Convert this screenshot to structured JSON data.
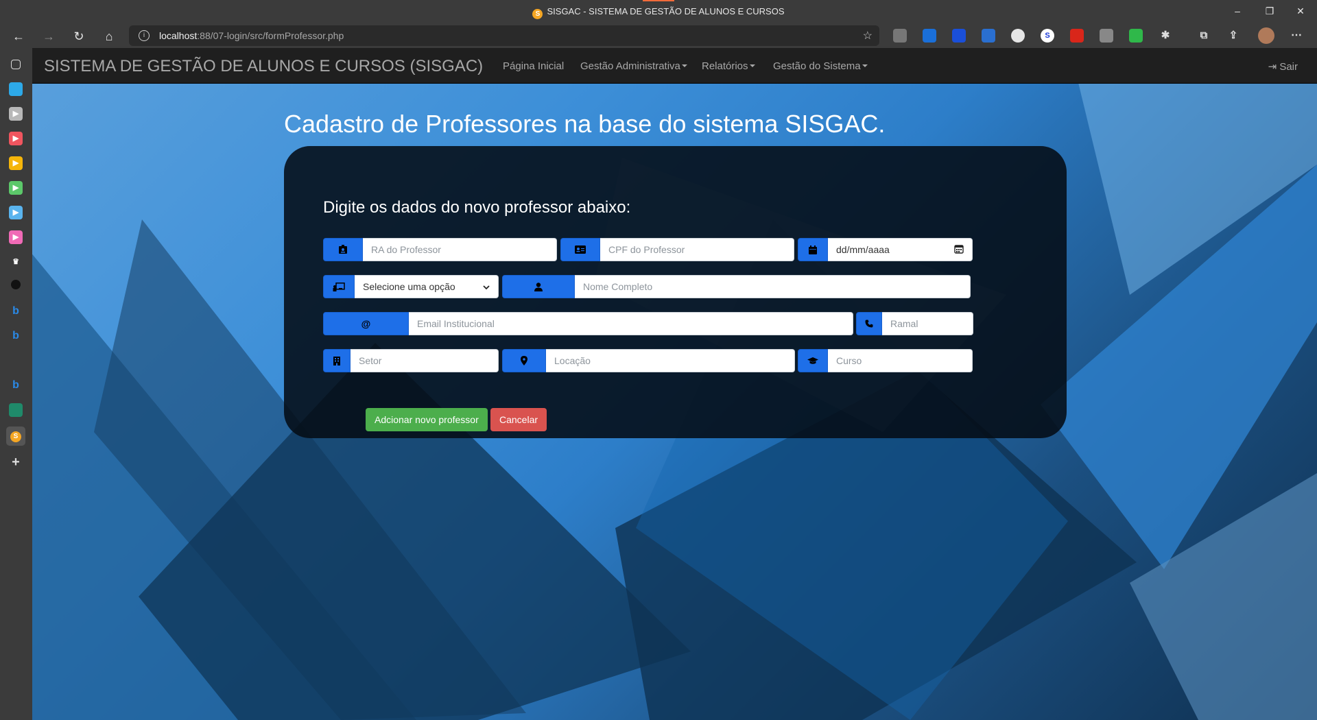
{
  "window": {
    "title": "SISGAC - SISTEMA DE GESTÃO DE ALUNOS E CURSOS",
    "favicon_letter": "S"
  },
  "browser": {
    "url_host": "localhost",
    "url_path": ":88/07-login/src/formProfessor.php"
  },
  "app": {
    "brand": "SISTEMA DE GESTÃO DE ALUNOS E CURSOS (SISGAC)",
    "nav": {
      "home": "Página Inicial",
      "admin": "Gestão Administrativa",
      "reports": "Relatórios",
      "system": "Gestão do Sistema"
    },
    "logout": "Sair"
  },
  "page": {
    "heading": "Cadastro de Professores na base do sistema SISGAC.",
    "subtitle": "Digite os dados do novo professor abaixo:"
  },
  "form": {
    "ra_placeholder": "RA do Professor",
    "cpf_placeholder": "CPF do Professor",
    "date_value": "dd/mm/aaaa",
    "select_value": "Selecione uma opção",
    "name_placeholder": "Nome Completo",
    "email_addon": "@",
    "email_placeholder": "Email Institucional",
    "ramal_placeholder": "Ramal",
    "setor_placeholder": "Setor",
    "locacao_placeholder": "Locação",
    "curso_placeholder": "Curso"
  },
  "buttons": {
    "add": "Adcionar novo professor",
    "cancel": "Cancelar"
  },
  "colors": {
    "addon_blue": "#1e6fe8",
    "green": "#4cae4c",
    "red": "#d9534f"
  }
}
